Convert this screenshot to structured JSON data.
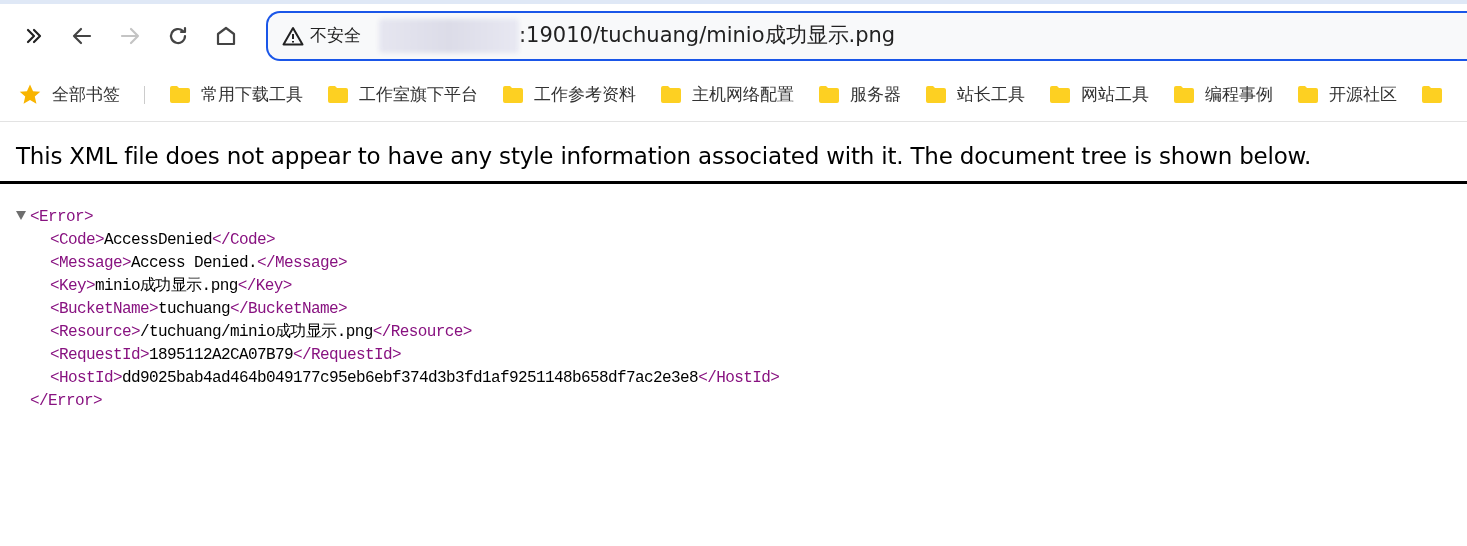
{
  "toolbar": {
    "forward_disabled": true
  },
  "address_bar": {
    "security_label": "不安全",
    "url": ":19010/tuchuang/minio成功显示.png",
    "focused": true
  },
  "bookmarks": [
    {
      "label": "全部书签",
      "kind": "all"
    },
    {
      "label": "常用下载工具",
      "kind": "folder"
    },
    {
      "label": "工作室旗下平台",
      "kind": "folder"
    },
    {
      "label": "工作参考资料",
      "kind": "folder"
    },
    {
      "label": "主机网络配置",
      "kind": "folder"
    },
    {
      "label": "服务器",
      "kind": "folder"
    },
    {
      "label": "站长工具",
      "kind": "folder"
    },
    {
      "label": "网站工具",
      "kind": "folder"
    },
    {
      "label": "编程事例",
      "kind": "folder"
    },
    {
      "label": "开源社区",
      "kind": "folder"
    }
  ],
  "notice": "This XML file does not appear to have any style information associated with it. The document tree is shown below.",
  "xml_tree": {
    "open": "<Error>",
    "close": "</Error>",
    "expanded": true,
    "children": [
      {
        "open": "<Code>",
        "value": "AccessDenied",
        "close": "</Code>"
      },
      {
        "open": "<Message>",
        "value": "Access Denied.",
        "close": "</Message>"
      },
      {
        "open": "<Key>",
        "value": "minio成功显示.png",
        "close": "</Key>"
      },
      {
        "open": "<BucketName>",
        "value": "tuchuang",
        "close": "</BucketName>"
      },
      {
        "open": "<Resource>",
        "value": "/tuchuang/minio成功显示.png",
        "close": "</Resource>"
      },
      {
        "open": "<RequestId>",
        "value": "1895112A2CA07B79",
        "close": "</RequestId>"
      },
      {
        "open": "<HostId>",
        "value": "dd9025bab4ad464b049177c95eb6ebf374d3b3fd1af9251148b658df7ac2e3e8",
        "close": "</HostId>"
      }
    ]
  }
}
